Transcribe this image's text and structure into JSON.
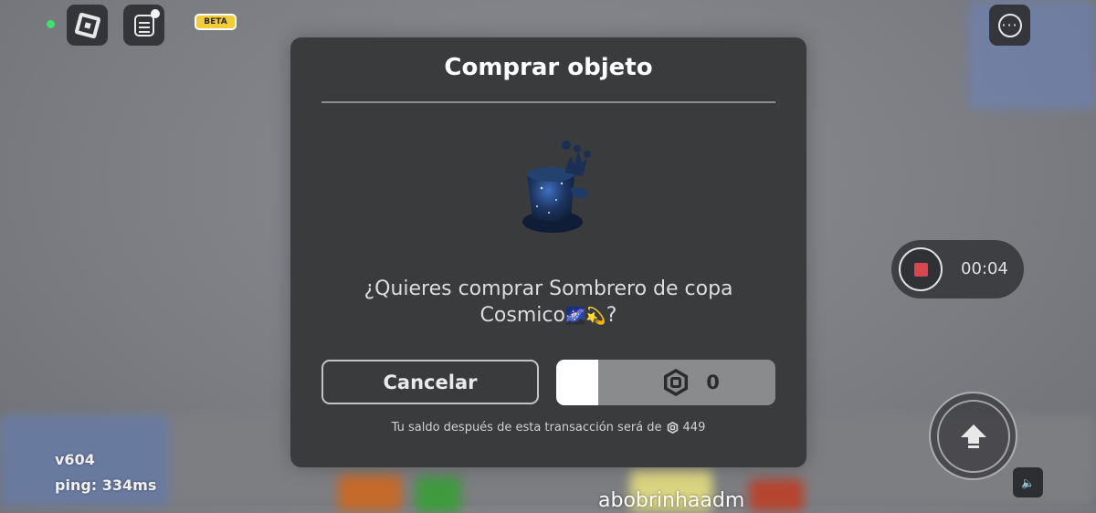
{
  "top_bar": {
    "beta_label": "BETA",
    "roblox_icon": "roblox-logo-icon",
    "chat_icon": "chat-icon",
    "menu_icon": "more-options-icon"
  },
  "dialog": {
    "title": "Comprar objeto",
    "item_icon": "cosmic-top-hat-image",
    "prompt_line1": "¿Quieres comprar Sombrero de copa",
    "prompt_item_name": "Cosmico",
    "prompt_emojis": "🌌💫",
    "prompt_end": "?",
    "cancel_label": "Cancelar",
    "buy_price": "0",
    "buy_progress": 0.19,
    "balance_text": "Tu saldo después de esta transacción será de",
    "balance_amount": "449"
  },
  "recording": {
    "time": "00:04",
    "stop_color": "#e0434b"
  },
  "stats": {
    "version": "v604",
    "ping": "ping: 334ms"
  },
  "player_name": "abobrinhaadm",
  "colors": {
    "dialog_bg": "#393b3d",
    "beta_bg": "#f3cd37",
    "status_dot": "#3be26b"
  }
}
